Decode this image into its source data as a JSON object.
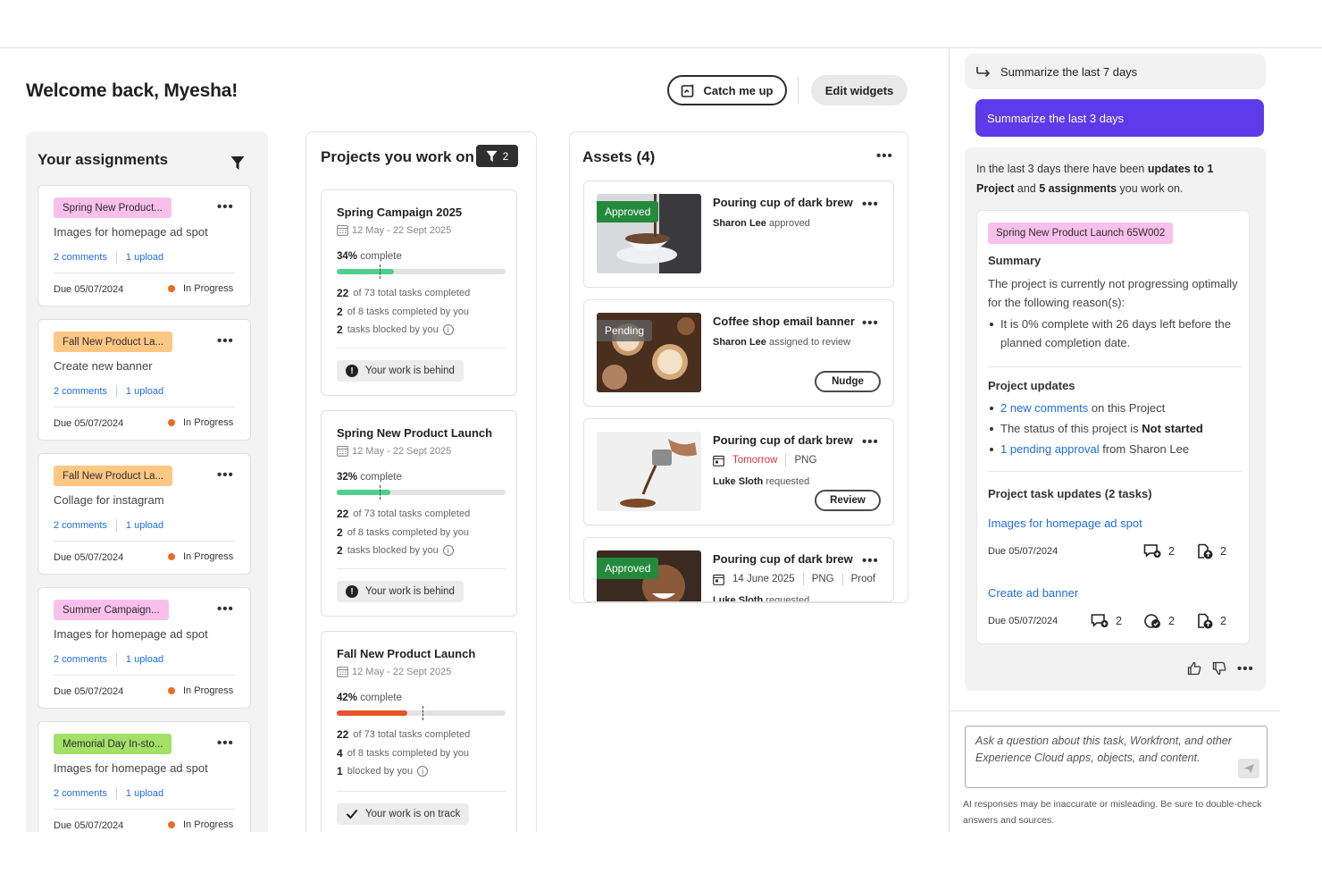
{
  "header": {
    "welcome": "Welcome back, Myesha!",
    "catch_me_up": "Catch me up",
    "edit_widgets": "Edit widgets"
  },
  "assignments": {
    "title": "Your assignments",
    "items": [
      {
        "tag": "Spring New Product...",
        "tag_color": "#f9c0ec",
        "title": "Images for homepage ad spot",
        "comments": "2 comments",
        "uploads": "1 upload",
        "due": "Due 05/07/2024",
        "status": "In Progress"
      },
      {
        "tag": "Fall New Product La...",
        "tag_color": "#ffc784",
        "title": "Create new banner",
        "comments": "2 comments",
        "uploads": "1 upload",
        "due": "Due 05/07/2024",
        "status": "In Progress"
      },
      {
        "tag": "Fall New Product La...",
        "tag_color": "#ffc784",
        "title": "Collage for instagram",
        "comments": "2 comments",
        "uploads": "1 upload",
        "due": "Due 05/07/2024",
        "status": "In Progress"
      },
      {
        "tag": "Summer Campaign...",
        "tag_color": "#f9c0ec",
        "title": "Images for homepage ad spot",
        "comments": "2 comments",
        "uploads": "1 upload",
        "due": "Due 05/07/2024",
        "status": "In Progress"
      },
      {
        "tag": "Memorial Day In-sto...",
        "tag_color": "#a3e068",
        "title": "Images for homepage ad spot",
        "comments": "2 comments",
        "uploads": "1 upload",
        "due": "Due 05/07/2024",
        "status": "In Progress"
      }
    ]
  },
  "projects": {
    "title": "Projects you work on",
    "filter_count": "2",
    "items": [
      {
        "name": "Spring Campaign 2025",
        "dates": "12 May - 22 Sept 2025",
        "pct": "34%",
        "pct_word": "complete",
        "progress": 0.34,
        "bar_color": "#4fcf8c",
        "l1_num": "22",
        "l1_text": "of 73 total tasks completed",
        "l2_num": "2",
        "l2_text": "of 8 tasks completed by you",
        "l3_num": "2",
        "l3_text": "tasks blocked by you",
        "status": "Your work is behind"
      },
      {
        "name": "Spring New Product Launch",
        "dates": "12 May - 22 Sept 2025",
        "pct": "32%",
        "pct_word": "complete",
        "progress": 0.32,
        "bar_color": "#4fcf8c",
        "l1_num": "22",
        "l1_text": "of 73 total tasks completed",
        "l2_num": "2",
        "l2_text": "of 8 tasks completed by you",
        "l3_num": "2",
        "l3_text": "tasks blocked by you",
        "status": "Your work is behind"
      },
      {
        "name": "Fall New Product Launch",
        "dates": "12 May - 22 Sept 2025",
        "pct": "42%",
        "pct_word": "complete",
        "progress": 0.42,
        "bar_color": "#e3552b",
        "l1_num": "22",
        "l1_text": "of 73 total tasks completed",
        "l2_num": "4",
        "l2_text": "of 8 tasks completed by you",
        "l3_num": "1",
        "l3_text": "blocked by you",
        "status": "Your work is on track"
      }
    ]
  },
  "assets": {
    "title": "Assets (4)",
    "items": [
      {
        "badge": "Approved",
        "title": "Pouring cup of dark brew",
        "person": "Sharon Lee",
        "action": "approved"
      },
      {
        "badge": "Pending",
        "title": "Coffee shop email banner",
        "person": "Sharon Lee",
        "action": "assigned to review",
        "button": "Nudge"
      },
      {
        "title": "Pouring cup of dark brew",
        "due": "Tomorrow",
        "format": "PNG",
        "person": "Luke Sloth",
        "action": "requested",
        "button": "Review"
      },
      {
        "badge": "Approved",
        "title": "Pouring cup of dark brew",
        "due": "14 June 2025",
        "format": "PNG",
        "kind": "Proof",
        "person": "Luke Sloth",
        "action": "requested"
      }
    ]
  },
  "assistant": {
    "prev_prompt": "Summarize the last 7 days",
    "active_prompt": "Summarize the last 3 days",
    "intro_a": "In the last 3 days there have been",
    "intro_b": "updates to 1 Project",
    "intro_c": "and",
    "intro_d": "5 assignments",
    "intro_e": "you work on.",
    "project_tag": "Spring New Product Launch 65W002",
    "summary_heading": "Summary",
    "summary_text": "The project is currently not progressing optimally for the following reason(s):",
    "summary_bullet": "It is 0% complete with 26 days left before the planned completion date.",
    "updates_heading": "Project updates",
    "update1_link": "2 new comments",
    "update1_rest": "on this Project",
    "update2_a": "The status of this project is",
    "update2_b": "Not started",
    "update3_link": "1 pending approval",
    "update3_rest": "from Sharon Lee",
    "task_heading": "Project task updates (2 tasks)",
    "tasks": [
      {
        "name": "Images for homepage ad spot",
        "due": "Due 05/07/2024",
        "comments": "2",
        "uploads": "2"
      },
      {
        "name": "Create ad banner",
        "due": "Due 05/07/2024",
        "comments": "2",
        "approvals": "2",
        "uploads": "2"
      }
    ],
    "ask_placeholder": "Ask a question about this task, Workfront, and other Experience Cloud apps, objects, and content.",
    "disclaimer": "AI responses may be inaccurate or misleading. Be sure to double-check answers and sources."
  }
}
